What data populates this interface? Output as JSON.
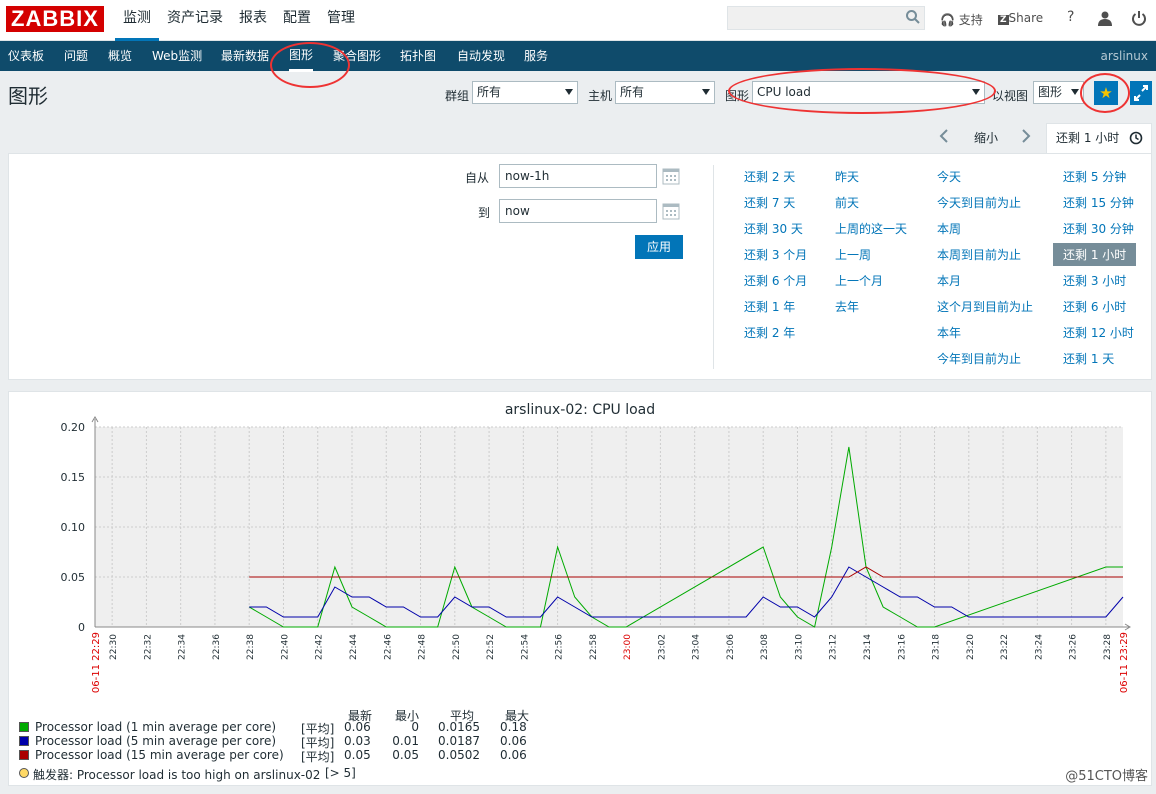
{
  "logo": "ZABBIX",
  "main_menu": [
    "监测",
    "资产记录",
    "报表",
    "配置",
    "管理"
  ],
  "top_links": {
    "support": "支持",
    "share": "Share",
    "help": "?"
  },
  "nav": [
    "仪表板",
    "问题",
    "概览",
    "Web监测",
    "最新数据",
    "图形",
    "聚合图形",
    "拓扑图",
    "自动发现",
    "服务"
  ],
  "nav_active": "图形",
  "user": "arslinux",
  "page_title": "图形",
  "filters": {
    "group_label": "群组",
    "group_value": "所有",
    "host_label": "主机",
    "host_value": "所有",
    "graph_label": "图形",
    "graph_value": "CPU load",
    "view_label": "以视图",
    "view_value": "图形"
  },
  "timeselector": {
    "zoom_out": "缩小",
    "active_tab": "还剩 1 小时",
    "from_label": "自从",
    "from_value": "now-1h",
    "to_label": "到",
    "to_value": "now",
    "apply": "应用",
    "quick": [
      [
        "还剩 2 天",
        "还剩 7 天",
        "还剩 30 天",
        "还剩 3 个月",
        "还剩 6 个月",
        "还剩 1 年",
        "还剩 2 年"
      ],
      [
        "昨天",
        "前天",
        "上周的这一天",
        "上一周",
        "上一个月",
        "去年"
      ],
      [
        "今天",
        "今天到目前为止",
        "本周",
        "本周到目前为止",
        "本月",
        "这个月到目前为止",
        "本年",
        "今年到目前为止"
      ],
      [
        "还剩 5 分钟",
        "还剩 15 分钟",
        "还剩 30 分钟",
        "还剩 1 小时",
        "还剩 3 小时",
        "还剩 6 小时",
        "还剩 12 小时",
        "还剩 1 天"
      ]
    ],
    "quick_active": "还剩 1 小时"
  },
  "chart_data": {
    "type": "line",
    "title": "arslinux-02: CPU load",
    "ylim": [
      0,
      0.2
    ],
    "yticks": [
      "0",
      "0.05",
      "0.10",
      "0.15",
      "0.20"
    ],
    "xlim": [
      "22:29",
      "23:29"
    ],
    "start_label": "06-11 22:29",
    "end_label": "06-11 23:29",
    "xticks": [
      "22:30",
      "22:32",
      "22:34",
      "22:36",
      "22:38",
      "22:40",
      "22:42",
      "22:44",
      "22:46",
      "22:48",
      "22:50",
      "22:52",
      "22:54",
      "22:56",
      "22:58",
      "23:00",
      "23:02",
      "23:04",
      "23:06",
      "23:08",
      "23:10",
      "23:12",
      "23:14",
      "23:16",
      "23:18",
      "23:20",
      "23:22",
      "23:24",
      "23:26",
      "23:28"
    ],
    "highlight_tick": "23:00",
    "grid": true,
    "series": [
      {
        "name": "Processor load (1 min average per core)",
        "color": "#00aa00",
        "x": [
          "22:38",
          "22:39",
          "22:40",
          "22:41",
          "22:42",
          "22:43",
          "22:44",
          "22:45",
          "22:46",
          "22:47",
          "22:48",
          "22:49",
          "22:50",
          "22:51",
          "22:52",
          "22:53",
          "22:54",
          "22:55",
          "22:56",
          "22:57",
          "22:58",
          "22:59",
          "23:00",
          "23:08",
          "23:09",
          "23:10",
          "23:11",
          "23:12",
          "23:13",
          "23:14",
          "23:15",
          "23:16",
          "23:17",
          "23:18",
          "23:28",
          "23:29"
        ],
        "values": [
          0.02,
          0.01,
          0,
          0,
          0,
          0.06,
          0.02,
          0.01,
          0,
          0,
          0,
          0,
          0.06,
          0.02,
          0.01,
          0,
          0,
          0,
          0.08,
          0.03,
          0.01,
          0,
          0,
          0.08,
          0.03,
          0.01,
          0,
          0.08,
          0.18,
          0.06,
          0.02,
          0.01,
          0,
          0,
          0.06,
          0.06
        ]
      },
      {
        "name": "Processor load (5 min average per core)",
        "color": "#0000aa",
        "x": [
          "22:38",
          "22:39",
          "22:40",
          "22:41",
          "22:42",
          "22:43",
          "22:44",
          "22:45",
          "22:46",
          "22:47",
          "22:48",
          "22:49",
          "22:50",
          "22:51",
          "22:52",
          "22:53",
          "22:54",
          "22:55",
          "22:56",
          "22:57",
          "22:58",
          "23:07",
          "23:08",
          "23:09",
          "23:10",
          "23:11",
          "23:12",
          "23:13",
          "23:14",
          "23:15",
          "23:16",
          "23:17",
          "23:18",
          "23:19",
          "23:20",
          "23:21",
          "23:22",
          "23:28",
          "23:29"
        ],
        "values": [
          0.02,
          0.02,
          0.01,
          0.01,
          0.01,
          0.04,
          0.03,
          0.03,
          0.02,
          0.02,
          0.01,
          0.01,
          0.03,
          0.02,
          0.02,
          0.01,
          0.01,
          0.01,
          0.03,
          0.02,
          0.01,
          0.01,
          0.03,
          0.02,
          0.02,
          0.01,
          0.03,
          0.06,
          0.05,
          0.04,
          0.03,
          0.03,
          0.02,
          0.02,
          0.01,
          0.01,
          0.01,
          0.01,
          0.03
        ]
      },
      {
        "name": "Processor load (15 min average per core)",
        "color": "#aa0000",
        "x": [
          "22:38",
          "23:12",
          "23:13",
          "23:14",
          "23:15",
          "23:16",
          "23:29"
        ],
        "values": [
          0.05,
          0.05,
          0.05,
          0.06,
          0.05,
          0.05,
          0.05
        ]
      }
    ],
    "stats_headers": [
      "最新",
      "最小",
      "平均",
      "最大"
    ],
    "legend_rows": [
      {
        "name": "Processor load (1 min average per core)",
        "func": "[平均]",
        "last": "0.06",
        "min": "0",
        "avg": "0.0165",
        "max": "0.18",
        "color": "#00aa00"
      },
      {
        "name": "Processor load (5 min average per core)",
        "func": "[平均]",
        "last": "0.03",
        "min": "0.01",
        "avg": "0.0187",
        "max": "0.06",
        "color": "#0000aa"
      },
      {
        "name": "Processor load (15 min average per core)",
        "func": "[平均]",
        "last": "0.05",
        "min": "0.05",
        "avg": "0.0502",
        "max": "0.06",
        "color": "#aa0000"
      }
    ],
    "trigger": {
      "label": "触发器: Processor load is too high on arslinux-02",
      "condition": "[> 5]"
    }
  },
  "watermark": "@51CTO博客"
}
